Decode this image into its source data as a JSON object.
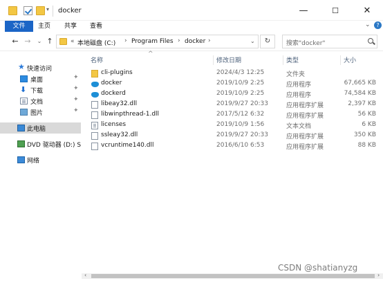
{
  "window": {
    "title": "docker",
    "minimize": "—",
    "maximize": "☐",
    "close": "✕"
  },
  "ribbon": {
    "tabs": [
      "文件",
      "主页",
      "共享",
      "查看"
    ],
    "expand": "⌄",
    "help": "?"
  },
  "nav": {
    "back": "←",
    "forward": "→",
    "recent": "⌄",
    "up": "↑",
    "breadcrumbs": [
      "«",
      "本地磁盘 (C:)",
      "Program Files",
      "docker"
    ],
    "separator": "›",
    "dropdown": "⌄",
    "refresh": "↻",
    "search_placeholder": "搜索\"docker\""
  },
  "sidebar": {
    "quick_access": "快速访问",
    "items": [
      {
        "label": "桌面",
        "icon": "desktop-icon",
        "pinned": true
      },
      {
        "label": "下载",
        "icon": "download-icon",
        "pinned": true
      },
      {
        "label": "文档",
        "icon": "document-icon",
        "pinned": true
      },
      {
        "label": "图片",
        "icon": "picture-icon",
        "pinned": true
      }
    ],
    "this_pc": "此电脑",
    "dvd": "DVD 驱动器 (D:) SSS",
    "network": "网络",
    "pin_glyph": "✦"
  },
  "columns": {
    "name": "名称",
    "date": "修改日期",
    "type": "类型",
    "size": "大小",
    "sort_caret": "^"
  },
  "files": [
    {
      "name": "cli-plugins",
      "date": "2024/4/3 12:25",
      "type": "文件夹",
      "size": "",
      "icon": "folder-icon"
    },
    {
      "name": "docker",
      "date": "2019/10/9 2:25",
      "type": "应用程序",
      "size": "67,665 KB",
      "icon": "docker-icon"
    },
    {
      "name": "dockerd",
      "date": "2019/10/9 2:25",
      "type": "应用程序",
      "size": "74,584 KB",
      "icon": "docker-icon"
    },
    {
      "name": "libeay32.dll",
      "date": "2019/9/27 20:33",
      "type": "应用程序扩展",
      "size": "2,397 KB",
      "icon": "dll-icon"
    },
    {
      "name": "libwinpthread-1.dll",
      "date": "2017/5/12 6:32",
      "type": "应用程序扩展",
      "size": "56 KB",
      "icon": "dll-icon"
    },
    {
      "name": "licenses",
      "date": "2019/10/9 1:56",
      "type": "文本文档",
      "size": "6 KB",
      "icon": "text-file-icon"
    },
    {
      "name": "ssleay32.dll",
      "date": "2019/9/27 20:33",
      "type": "应用程序扩展",
      "size": "350 KB",
      "icon": "dll-icon"
    },
    {
      "name": "vcruntime140.dll",
      "date": "2016/6/10 6:53",
      "type": "应用程序扩展",
      "size": "88 KB",
      "icon": "dll-icon"
    }
  ],
  "scrollbar": {
    "left": "‹",
    "right": "›"
  },
  "watermark": "CSDN @shatianyzg"
}
